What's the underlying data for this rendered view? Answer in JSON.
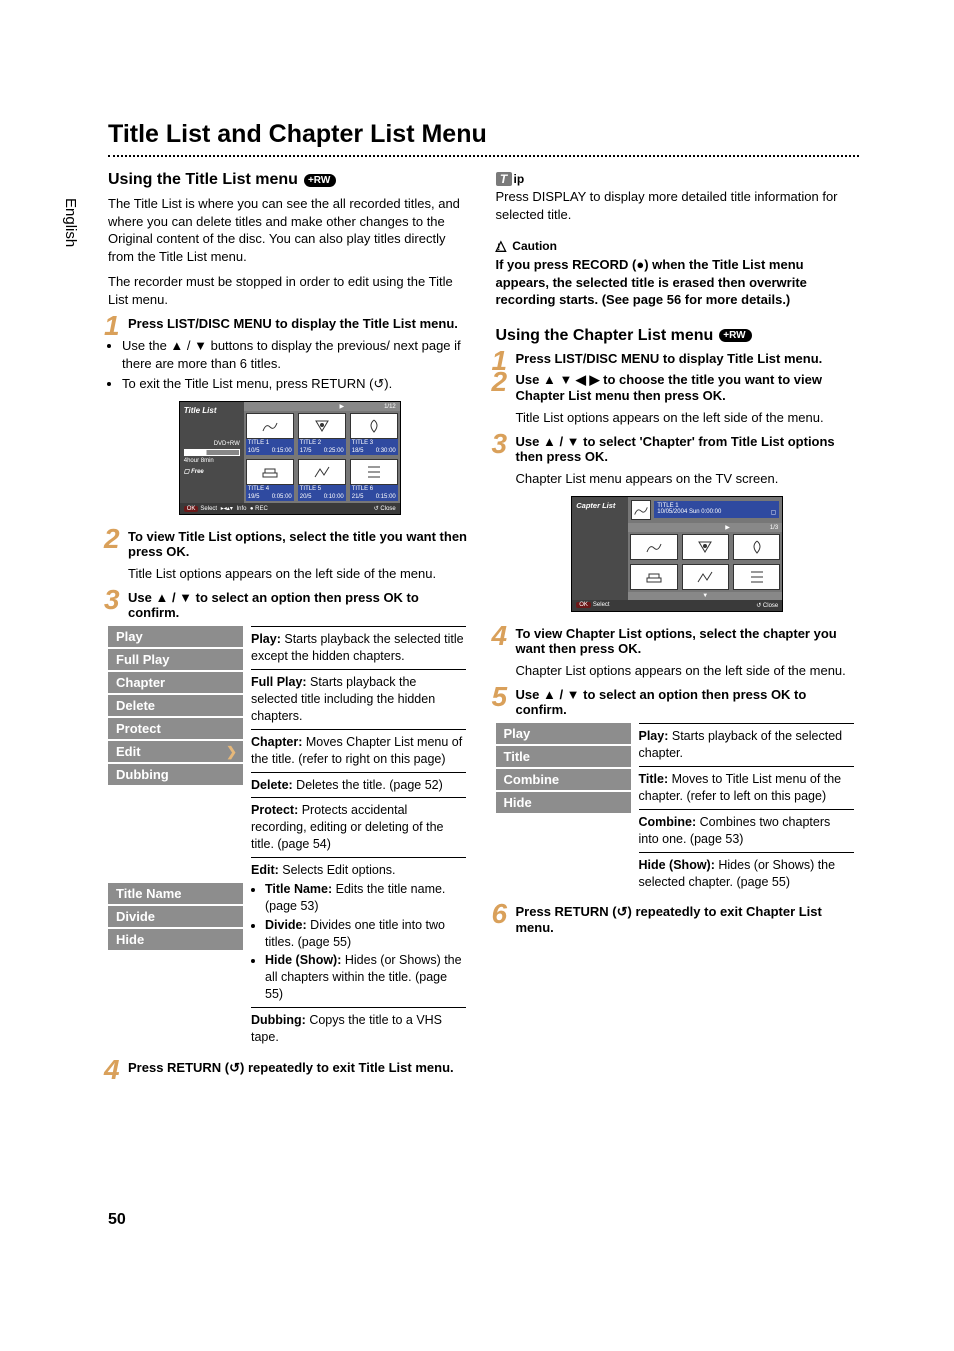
{
  "sideLang": "English",
  "mainTitle": "Title List and Chapter List Menu",
  "left": {
    "heading": "Using the Title List menu",
    "badge": "+RW",
    "intro1": "The Title List is where you can see the all recorded titles, and where you can delete titles and make other changes to the Original content of the disc. You can also play titles directly from the Title List menu.",
    "intro2": "The recorder must be stopped in order to edit using the Title List menu.",
    "step1": "Press LIST/DISC MENU to display the Title List menu.",
    "bullet1": "Use the ▲ / ▼ buttons to display the previous/ next page if there are more than 6 titles.",
    "bullet2": "To exit the Title List menu, press RETURN (↺).",
    "step2": "To view Title List options, select the title you want then press OK.",
    "step2b": "Title List options appears on the left side of the menu.",
    "step3": "Use ▲ / ▼ to select an option then press OK to confirm.",
    "menuA": [
      "Play",
      "Full Play",
      "Chapter",
      "Delete",
      "Protect",
      "Edit",
      "Dubbing"
    ],
    "menuB": [
      "Title Name",
      "Divide",
      "Hide"
    ],
    "descs": {
      "play": "Play: Starts playback the selected title except the hidden chapters.",
      "fullplay": "Full Play: Starts playback the selected title including the hidden chapters.",
      "chapter": "Chapter: Moves Chapter List menu of the title. (refer to right on this page)",
      "delete": "Delete: Deletes the title. (page 52)",
      "protect": "Protect: Protects accidental recording, editing or deleting of the title. (page 54)",
      "edit": "Edit: Selects Edit options.",
      "edit_items": [
        "Title Name: Edits the title name. (page 53)",
        "Divide: Divides one title into two titles. (page 55)",
        "Hide (Show): Hides (or Shows) the all chapters within the title. (page 55)"
      ],
      "dubbing": "Dubbing: Copys the title to a VHS tape."
    },
    "step4": "Press RETURN (↺) repeatedly to exit Title List menu.",
    "scr": {
      "title": "Title List",
      "media": "DVD+RW",
      "dur": "4hour 8min",
      "free": "▢ Free",
      "page": "1/12",
      "titles": [
        {
          "name": "TITLE 1",
          "a": "10/5",
          "b": "0:15:00"
        },
        {
          "name": "TITLE 2",
          "a": "17/5",
          "b": "0:25:00"
        },
        {
          "name": "TITLE 3",
          "a": "18/5",
          "b": "0:30:00"
        },
        {
          "name": "TITLE 4",
          "a": "19/5",
          "b": "0:05:00"
        },
        {
          "name": "TITLE 5",
          "a": "20/5",
          "b": "0:10:00"
        },
        {
          "name": "TITLE 6",
          "a": "21/5",
          "b": "0:15:00"
        }
      ],
      "foot_select": "Select",
      "foot_info": "Info",
      "foot_rec": "● REC",
      "foot_close": "Close"
    }
  },
  "right": {
    "tip_label": "ip",
    "tip_text": "Press DISPLAY to display more detailed title information for selected title.",
    "caution_label": "Caution",
    "caution_text": "If you press RECORD (●) when the Title List menu appears, the selected title is erased then overwrite recording starts. (See page 56 for more details.)",
    "heading": "Using the Chapter List menu",
    "badge": "+RW",
    "step1": "Press LIST/DISC MENU to display Title List menu.",
    "step2": "Use ▲ ▼ ◀ ▶ to choose the title you want to view Chapter List menu then press OK.",
    "step2b": "Title List options appears on the left side of the menu.",
    "step3": "Use ▲ / ▼ to select 'Chapter' from Title List options then press OK.",
    "step3b": "Chapter List menu appears on the TV screen.",
    "scr": {
      "title": "Capter List",
      "t1": "TITLE 1",
      "t1sub": "10/05/2004 Sun 0:00:00",
      "page": "1/3",
      "foot_select": "Select",
      "foot_close": "Close"
    },
    "step4": "To view Chapter List options, select the chapter you want then press OK.",
    "step4b": "Chapter List options appears on the left side of the menu.",
    "step5": "Use ▲ / ▼ to select an option then press OK to confirm.",
    "menu": [
      "Play",
      "Title",
      "Combine",
      "Hide"
    ],
    "descs": {
      "play": "Play: Starts playback of the selected chapter.",
      "title": "Title: Moves to Title List menu of the chapter. (refer to left on this page)",
      "combine": "Combine: Combines two chapters into one. (page 53)",
      "hide": "Hide (Show): Hides (or Shows) the selected chapter. (page 55)"
    },
    "step6": "Press RETURN (↺) repeatedly to exit Chapter List menu."
  },
  "pageNum": "50"
}
